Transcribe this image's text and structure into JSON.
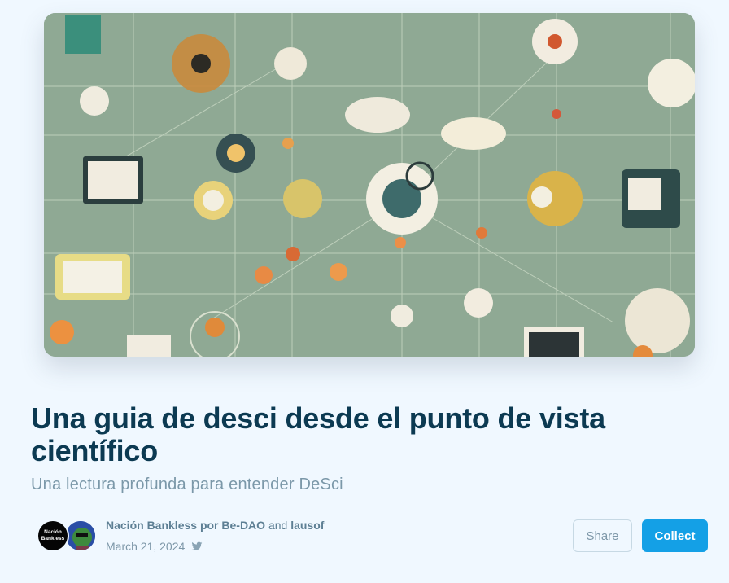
{
  "post": {
    "title": "Una guia de desci desde el punto de vista científico",
    "subtitle": "Una lectura profunda para entender DeSci",
    "publication": "Nación Bankless por Be-DAO",
    "connector": "and",
    "coauthor": "lausof",
    "date": "March 21, 2024",
    "avatar_text": [
      "Nación",
      "Bankless"
    ]
  },
  "actions": {
    "share_label": "Share",
    "collect_label": "Collect"
  },
  "icons": {
    "social": "twitter-icon"
  },
  "colors": {
    "background": "#f0f8ff",
    "title": "#0c3a52",
    "subtitle": "#7b98a9",
    "accent": "#14a0e6",
    "hero_bg": "#8da892"
  }
}
